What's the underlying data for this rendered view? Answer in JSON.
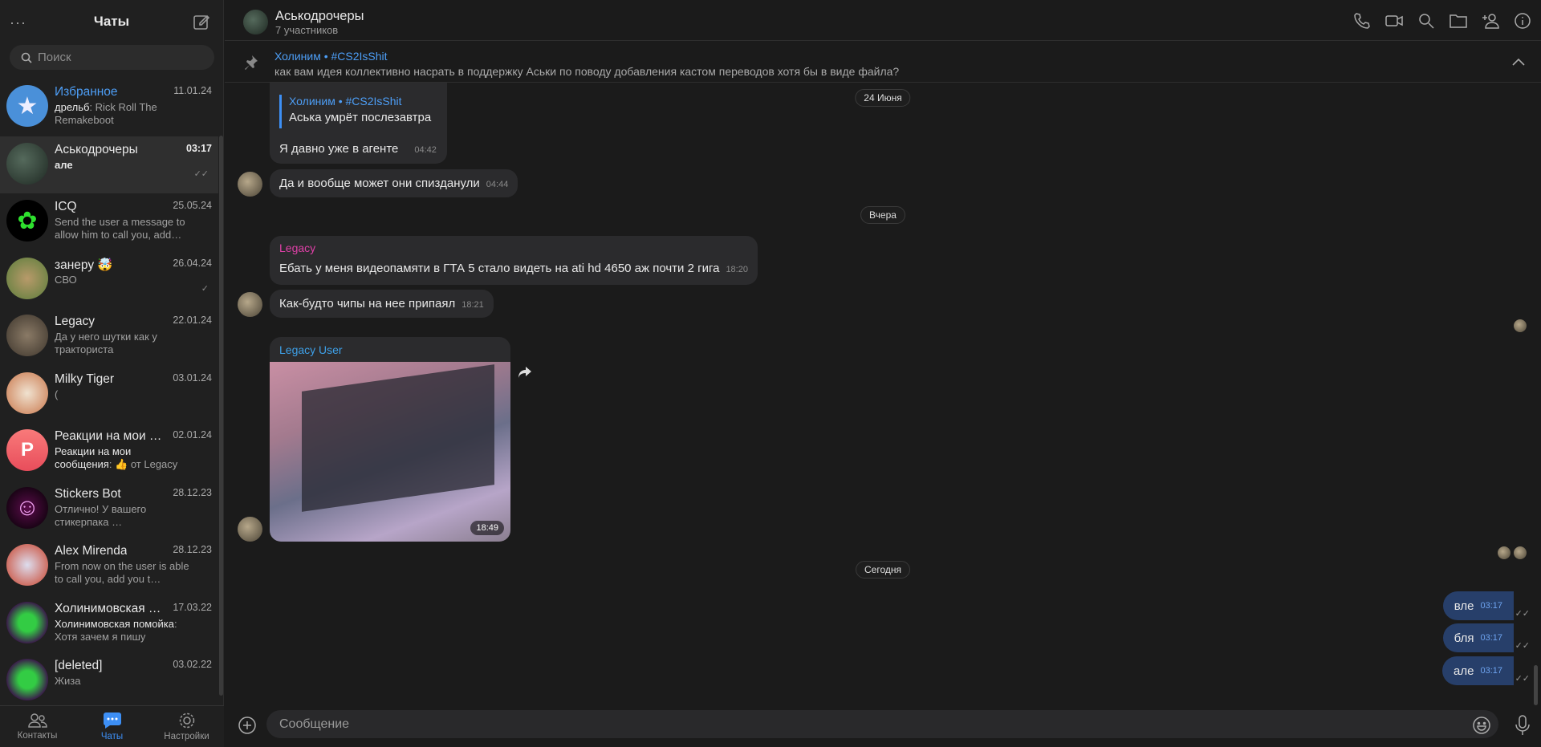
{
  "sidebar": {
    "title": "Чаты",
    "menu": "···",
    "search_placeholder": "Поиск",
    "chats": [
      {
        "name": "Избранное",
        "date": "11.01.24",
        "sender": "дрельб",
        "preview": "Rick Roll The Remakeboot",
        "color": "#4a90d9"
      },
      {
        "name": "Аськодрочеры",
        "date": "03:17",
        "sender": "але",
        "preview": "",
        "status": "✓✓"
      },
      {
        "name": "ICQ",
        "date": "25.05.24",
        "preview": "Send the user a message to allow him to call you, add…"
      },
      {
        "name": "занеру 🤯",
        "date": "26.04.24",
        "preview": "СВО",
        "status": "✓"
      },
      {
        "name": "Legacy",
        "date": "22.01.24",
        "preview": "Да у него шутки как у тракториста"
      },
      {
        "name": "Milky Tiger",
        "date": "03.01.24",
        "preview": "("
      },
      {
        "name": "Реакции на мои с…",
        "date": "02.01.24",
        "sender": "Реакции на мои сообщения",
        "preview": "👍 от Legacy",
        "letter": "P"
      },
      {
        "name": "Stickers Bot",
        "date": "28.12.23",
        "preview": "Отлично! У вашего стикерпака …"
      },
      {
        "name": "Alex Mirenda",
        "date": "28.12.23",
        "preview": "From now on the user is able to call you, add you t…"
      },
      {
        "name": "Холинимовская п…",
        "date": "17.03.22",
        "sender": "Холинимовская помойка",
        "preview": "Хотя зачем я пишу"
      },
      {
        "name": "[deleted]",
        "date": "03.02.22",
        "preview": "Жиза"
      }
    ],
    "nav": {
      "contacts": "Контакты",
      "chats": "Чаты",
      "settings": "Настройки"
    }
  },
  "header": {
    "title": "Аськодрочеры",
    "subtitle": "7 участников"
  },
  "pinned": {
    "author": "Холиним • #CS2IsShit",
    "text": "как вам идея коллективно насрать в поддержку Аськи по поводу добавления кастом переводов хотя бы в виде файла?"
  },
  "messages": {
    "d1": "24 Июня",
    "d2": "Вчера",
    "d3": "Сегодня",
    "m1": {
      "quote_author": "Холиним • #CS2IsShit",
      "quote_text": "Аська умрёт послезавтра",
      "text": "Я давно уже в агенте",
      "time": "04:42"
    },
    "m2": {
      "text": "Да и вообще может они спизданули",
      "time": "04:44"
    },
    "m3": {
      "author": "Legacy",
      "text": "Ебать у меня видеопамяти в ГТА 5 стало видеть на  ati hd 4650 аж почти 2 гига",
      "time": "18:20"
    },
    "m4": {
      "text": "Как-будто чипы на нее припаял",
      "time": "18:21"
    },
    "m5": {
      "author": "Legacy User",
      "time": "18:49"
    },
    "own": [
      {
        "text": "вле",
        "time": "03:17"
      },
      {
        "text": "бля",
        "time": "03:17"
      },
      {
        "text": "але",
        "time": "03:17"
      }
    ]
  },
  "composer": {
    "placeholder": "Сообщение"
  }
}
